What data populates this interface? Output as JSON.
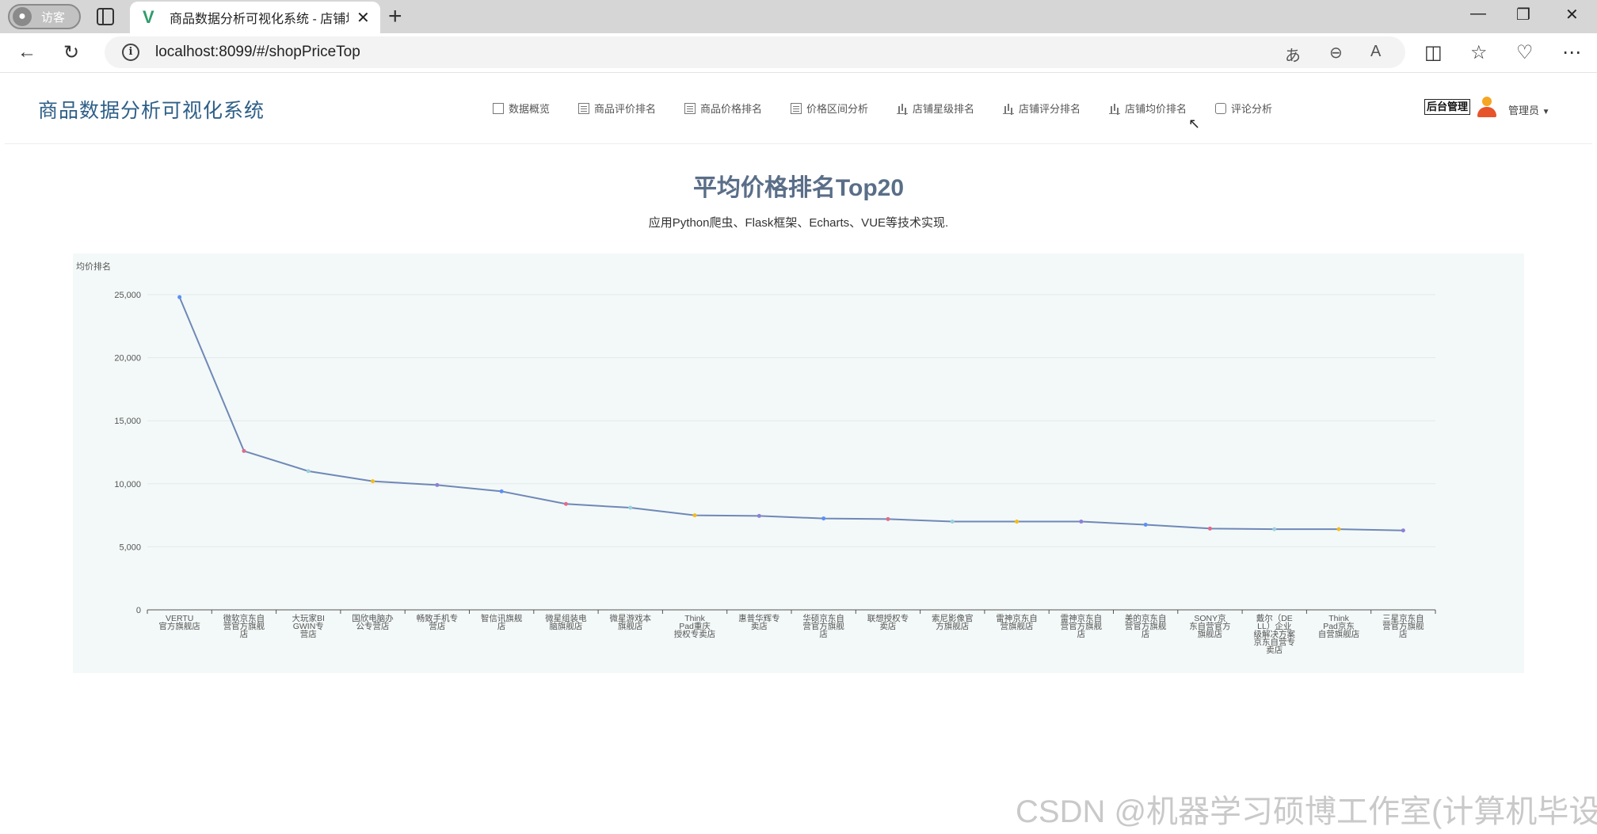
{
  "browser": {
    "profile_label": "访客",
    "tab_title": "商品数据分析可视化系统 - 店铺均价排名",
    "url": "localhost:8099/#/shopPriceTop"
  },
  "app": {
    "brand": "商品数据分析可视化系统",
    "nav": [
      {
        "label": "数据概览",
        "icon": "doc-icon"
      },
      {
        "label": "商品评价排名",
        "icon": "list-icon"
      },
      {
        "label": "商品价格排名",
        "icon": "list-icon"
      },
      {
        "label": "价格区间分析",
        "icon": "list-icon"
      },
      {
        "label": "店铺星级排名",
        "icon": "bar-chart-icon"
      },
      {
        "label": "店铺评分排名",
        "icon": "bar-chart-icon"
      },
      {
        "label": "店铺均价排名",
        "icon": "bar-chart-icon"
      },
      {
        "label": "评论分析",
        "icon": "comment-icon"
      }
    ],
    "admin_button": "后台管理",
    "user_name": "管理员"
  },
  "page": {
    "title": "平均价格排名Top20",
    "subtitle": "应用Python爬虫、Flask框架、Echarts、VUE等技术实现."
  },
  "chart_data": {
    "type": "line",
    "ylabel": "均价排名",
    "ylim": [
      0,
      25000
    ],
    "yticks": [
      "0",
      "5,000",
      "10,000",
      "15,000",
      "20,000",
      "25,000"
    ],
    "grid": true,
    "categories": [
      "VERTU官方旗舰店",
      "微软京东自营官方旗舰店",
      "大玩家BIGWIN专营店",
      "国欣电脑办公专营店",
      "畅致手机专营店",
      "智信讯旗舰店",
      "微星组装电脑旗舰店",
      "微星游戏本旗舰店",
      "ThinkPad重庆授权专卖店",
      "惠普华辉专卖店",
      "华硕京东自营官方旗舰店",
      "联想授权专卖店",
      "索尼影像官方旗舰店",
      "雷神京东自营旗舰店",
      "雷神京东自营官方旗舰店",
      "美的京东自营官方旗舰店",
      "SONY京东自营官方旗舰店",
      "戴尔（DELL）企业级解决方案京东自营专卖店",
      "ThinkPad京东自营旗舰店",
      "三星京东自营官方旗舰店"
    ],
    "values": [
      24800,
      12600,
      11000,
      10200,
      9900,
      9400,
      8400,
      8100,
      7500,
      7450,
      7250,
      7200,
      7000,
      7000,
      7000,
      6750,
      6450,
      6400,
      6400,
      6300
    ],
    "line_color": "#6f88b8",
    "point_colors": [
      "#5b8ff9",
      "#e06b8b",
      "#9ad1e0",
      "#f6bd16",
      "#8f7fd6",
      "#5b8ff9",
      "#e06b8b",
      "#9ad1e0",
      "#f6bd16",
      "#8f7fd6",
      "#5b8ff9",
      "#e06b8b",
      "#9ad1e0",
      "#f6bd16",
      "#8f7fd6",
      "#5b8ff9",
      "#e06b8b",
      "#9ad1e0",
      "#f6bd16",
      "#8f7fd6"
    ]
  },
  "watermark": "CSDN @机器学习硕博工作室(计算机毕设)"
}
